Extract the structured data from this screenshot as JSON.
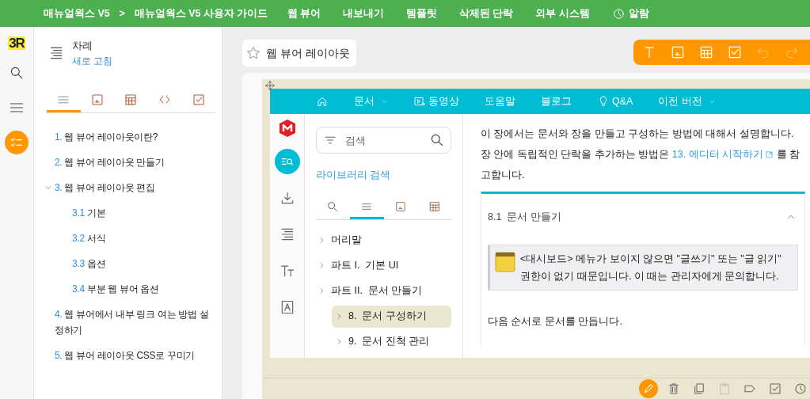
{
  "top_nav": {
    "breadcrumb": [
      "매뉴얼웍스 V5",
      "매뉴얼웍스 V5 사용자 가이드"
    ],
    "separator": ">",
    "menu": [
      "웹 뷰어",
      "내보내기",
      "템플릿",
      "삭제된 단락",
      "외부 시스템"
    ],
    "alarm": "알람"
  },
  "left_rail": {
    "logo": "3R",
    "items": [
      {
        "kind": "search",
        "selected": false
      },
      {
        "kind": "menu",
        "selected": false
      },
      {
        "kind": "checklist",
        "selected": true
      }
    ]
  },
  "toc": {
    "title": "차례",
    "refresh": "새로 고침",
    "tabs": [
      {
        "kind": "list",
        "selected": true
      },
      {
        "kind": "image",
        "selected": false
      },
      {
        "kind": "table",
        "selected": false
      },
      {
        "kind": "code",
        "selected": false
      },
      {
        "kind": "check",
        "selected": false
      }
    ],
    "items": [
      {
        "number": "1.",
        "title": "웹 뷰어 레이아웃이란?"
      },
      {
        "number": "2.",
        "title": "웹 뷰어 레이아웃 만들기"
      },
      {
        "number": "3.",
        "title": "웹 뷰어 레이아웃 편집",
        "expanded": true,
        "children": [
          {
            "number": "3.1",
            "title": "기본"
          },
          {
            "number": "3.2",
            "title": "서식"
          },
          {
            "number": "3.3",
            "title": "옵션"
          },
          {
            "number": "3.4",
            "title": "부분 웹 뷰어 옵션"
          }
        ]
      },
      {
        "number": "4.",
        "title": "웹 뷰어에서 내부 링크 여는 방법 설정하기"
      },
      {
        "number": "5.",
        "title": "웹 뷰어 레이아웃 CSS로 꾸미기"
      }
    ]
  },
  "page_title": {
    "text": "웹 뷰어 레이아웃",
    "starred": false
  },
  "editor_toolbar": [
    {
      "kind": "text",
      "disabled": false
    },
    {
      "kind": "image",
      "disabled": false
    },
    {
      "kind": "table",
      "disabled": false
    },
    {
      "kind": "check",
      "disabled": false
    },
    {
      "kind": "undo",
      "disabled": true
    },
    {
      "kind": "redo",
      "disabled": true
    }
  ],
  "preview": {
    "nav": [
      {
        "kind": "home"
      },
      {
        "kind": "dropdown",
        "label": "문서"
      },
      {
        "kind": "video",
        "label": "동영상"
      },
      {
        "kind": "plain",
        "label": "도움말"
      },
      {
        "kind": "plain",
        "label": "블로그"
      },
      {
        "kind": "bulb",
        "label": "Q&A"
      },
      {
        "kind": "dropdown",
        "label": "이전 버전"
      }
    ],
    "rail": [
      {
        "kind": "search-list",
        "selected": true
      },
      {
        "kind": "download",
        "selected": false
      },
      {
        "kind": "align",
        "selected": false
      },
      {
        "kind": "font-size",
        "selected": false
      },
      {
        "kind": "font-box",
        "selected": false
      }
    ],
    "search": {
      "placeholder": "검색"
    },
    "library_link": "라이브러리 검색",
    "tabs": [
      {
        "kind": "search",
        "selected": false
      },
      {
        "kind": "list",
        "selected": true
      },
      {
        "kind": "image",
        "selected": false
      },
      {
        "kind": "table",
        "selected": false
      }
    ],
    "tree": [
      {
        "title": "머리말",
        "selected": false
      },
      {
        "title": "파트 I.  기본 UI",
        "selected": false
      },
      {
        "title": "파트 II.  문서 만들기",
        "selected": false,
        "children": [
          {
            "title": "8.  문서 구성하기",
            "selected": true
          },
          {
            "title": "9.  문서 진척 관리",
            "selected": false
          }
        ]
      }
    ],
    "intro": {
      "before": "이 장에서는 문서와 장을 만들고 구성하는 방법에 대해서 설명합니다. 장 안에 독립적인 단락을 추가하는 방법은",
      "link": "13. 에디터 시작하기",
      "after": "를 참고합니다."
    },
    "section": {
      "number": "8.1",
      "title": "문서 만들기",
      "expanded": true,
      "note": "<대시보드> 메뉴가 보이지 않으면 \"글쓰기\" 또는 \"글 읽기\" 권한이 없기 때문입니다. 이 때는 관리자에게 문의합니다.",
      "paragraph": "다음 순서로 문서를 만듭니다."
    }
  },
  "bottom_toolbar": [
    {
      "kind": "pencil",
      "selected": true,
      "disabled": false
    },
    {
      "kind": "trash",
      "selected": false,
      "disabled": false
    },
    {
      "kind": "copy",
      "selected": false,
      "disabled": false
    },
    {
      "kind": "clipboard",
      "selected": false,
      "disabled": true
    },
    {
      "kind": "tag",
      "selected": false,
      "disabled": false
    },
    {
      "kind": "check",
      "selected": false,
      "disabled": false
    },
    {
      "kind": "clock",
      "selected": false,
      "disabled": false
    }
  ]
}
